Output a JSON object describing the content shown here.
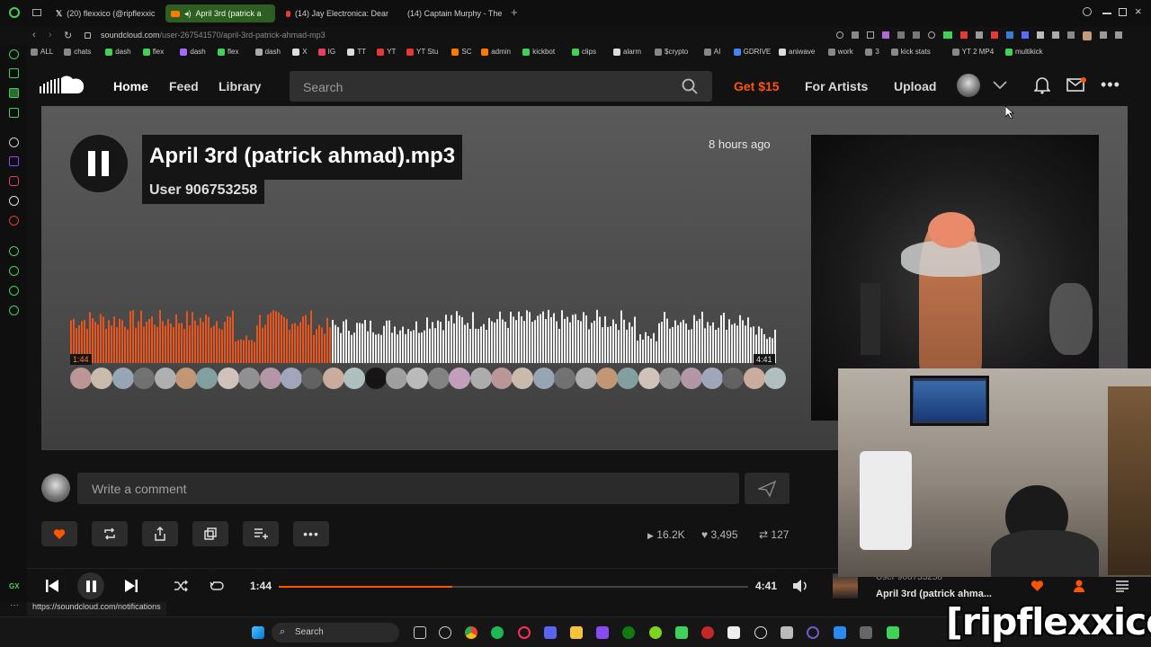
{
  "browser": {
    "tabs": [
      {
        "label": "(20) flexxico (@ripflexxic"
      },
      {
        "label": "April 3rd (patrick a"
      },
      {
        "label": "(14) Jay Electronica: Dear"
      },
      {
        "label": "(14) Captain Murphy - The"
      }
    ],
    "url_host": "soundcloud.com",
    "url_path": "/user-267541570/april-3rd-patrick-ahmad-mp3",
    "bookmarks": [
      "ALL",
      "chats",
      "dash",
      "flex",
      "dash",
      "flex",
      "dash",
      "X",
      "IG",
      "TT",
      "YT",
      "YT Stu",
      "SC",
      "admin",
      "kickbot",
      "clips",
      "alarm",
      "$crypto",
      "AI",
      "GDRIVE",
      "aniwave",
      "work",
      "3",
      "kick stats",
      "YT 2 MP4",
      "multikick"
    ]
  },
  "header": {
    "nav": {
      "home": "Home",
      "feed": "Feed",
      "library": "Library"
    },
    "search_placeholder": "Search",
    "get15": "Get $15",
    "for_artists": "For Artists",
    "upload": "Upload"
  },
  "track": {
    "title": "April 3rd (patrick ahmad).mp3",
    "user": "User 906753258",
    "posted": "8 hours ago",
    "elapsed": "1:44",
    "duration": "4:41",
    "progress": 0.37
  },
  "comment": {
    "placeholder": "Write a comment"
  },
  "stats": {
    "plays": "16.2K",
    "likes": "3,495",
    "reposts": "127"
  },
  "player": {
    "elapsed": "1:44",
    "duration": "4:41",
    "progress": 0.37,
    "user": "User 906753258",
    "title": "April 3rd (patrick ahma..."
  },
  "status_url": "https://soundcloud.com/notifications",
  "taskbar": {
    "search": "Search"
  },
  "watermark": "[ripflexxico]",
  "colors": {
    "accent": "#ff5500",
    "played": "#e8541e"
  }
}
